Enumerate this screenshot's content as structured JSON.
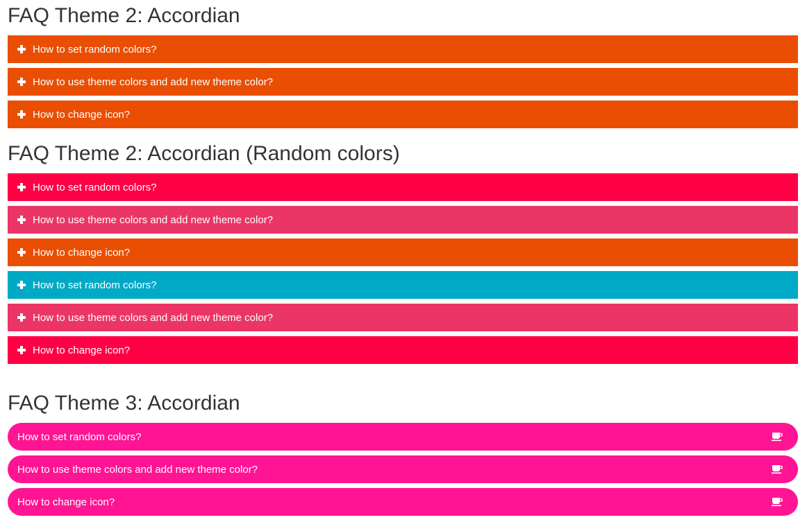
{
  "sections": [
    {
      "title": "FAQ Theme 2: Accordian",
      "items": [
        {
          "label": "How to set random colors?",
          "color": "#e94e02"
        },
        {
          "label": "How to use theme colors and add new theme color?",
          "color": "#e94e02"
        },
        {
          "label": "How to change icon?",
          "color": "#e94e02"
        }
      ],
      "icon": "plus-icon"
    },
    {
      "title": "FAQ Theme 2: Accordian (Random colors)",
      "items": [
        {
          "label": "How to set random colors?",
          "color": "#ff0045"
        },
        {
          "label": "How to use theme colors and add new theme color?",
          "color": "#ec3567"
        },
        {
          "label": "How to change icon?",
          "color": "#e94e02"
        },
        {
          "label": "How to set random colors?",
          "color": "#00a9c6"
        },
        {
          "label": "How to use theme colors and add new theme color?",
          "color": "#ec3567"
        },
        {
          "label": "How to change icon?",
          "color": "#ff0045"
        }
      ],
      "icon": "plus-icon"
    },
    {
      "title": "FAQ Theme 3: Accordian",
      "items": [
        {
          "label": "How to set random colors?",
          "color": "#ff1493"
        },
        {
          "label": "How to use theme colors and add new theme color?",
          "color": "#ff1493"
        },
        {
          "label": "How to change icon?",
          "color": "#ff1493"
        }
      ],
      "icon": "coffee-cup-icon"
    }
  ]
}
